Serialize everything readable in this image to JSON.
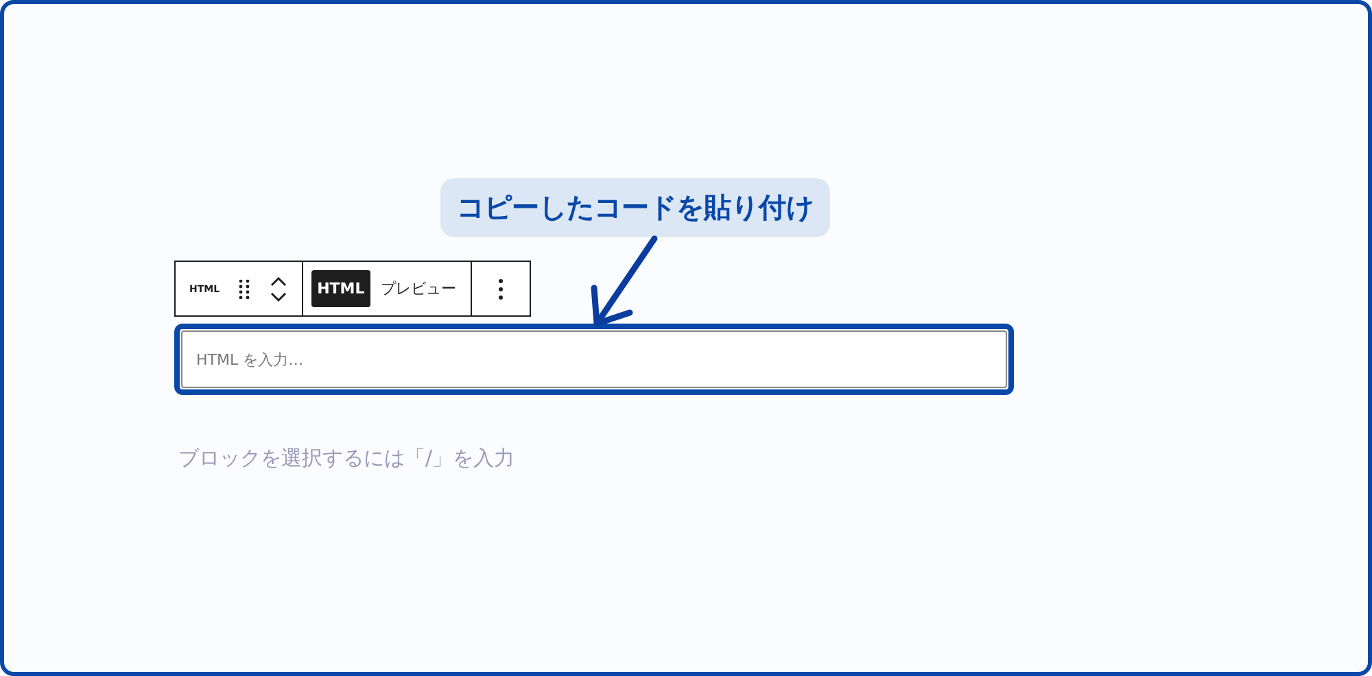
{
  "callout": {
    "text": "コピーしたコードを貼り付け"
  },
  "toolbar": {
    "block_label": "HTML",
    "tabs": [
      {
        "label": "HTML",
        "selected": true
      },
      {
        "label": "プレビュー",
        "selected": false
      }
    ]
  },
  "html_field": {
    "placeholder": "HTML を入力…",
    "focused": true
  },
  "hint": "ブロックを選択するには「/」を入力"
}
